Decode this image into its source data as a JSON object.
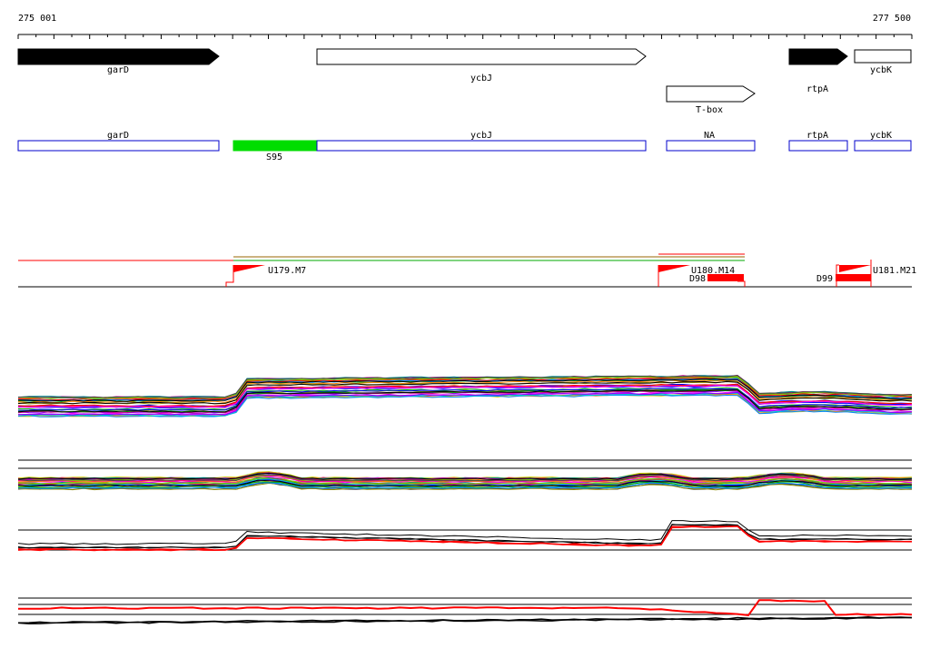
{
  "ruler": {
    "start_label": "275 001",
    "end_label": "277 500"
  },
  "genes": [
    {
      "name": "garD",
      "strand": "+",
      "filled": true
    },
    {
      "name": "ycbJ",
      "strand": "+",
      "filled": false
    },
    {
      "name": "T-box",
      "strand": "+",
      "filled": false
    },
    {
      "name": "rtpA",
      "strand": "+",
      "filled": true
    },
    {
      "name": "ycbK",
      "strand": "+",
      "filled": false
    }
  ],
  "segments": [
    {
      "name": "garD",
      "color": "#0000cc"
    },
    {
      "name": "ycbJ",
      "color": "#0000cc"
    },
    {
      "name": "NA",
      "color": "#0000cc"
    },
    {
      "name": "rtpA",
      "color": "#0000cc"
    },
    {
      "name": "ycbK",
      "color": "#0000cc"
    },
    {
      "name": "S95",
      "color": "#00dd00"
    }
  ],
  "features": [
    {
      "label": "U179.M7",
      "color": "#ff0000"
    },
    {
      "label": "U180.M14",
      "color": "#ff0000"
    },
    {
      "label": "D98",
      "color": "#ff0000"
    },
    {
      "label": "D99",
      "color": "#ff0000"
    },
    {
      "label": "U181.M21",
      "color": "#ff0000"
    }
  ],
  "colors": {
    "highlight": "#ff0000",
    "segment_outline": "#0000cc",
    "segment_fill_green": "#00dd00",
    "trace_palette": [
      "#ff0000",
      "#00aa00",
      "#0000ff",
      "#ff00ff",
      "#00cccc",
      "#cccc00",
      "#ff8800",
      "#8800ff",
      "#008888",
      "#888800",
      "#ff0088",
      "#0088ff",
      "#88cc00",
      "#cc0088",
      "#444444"
    ]
  }
}
